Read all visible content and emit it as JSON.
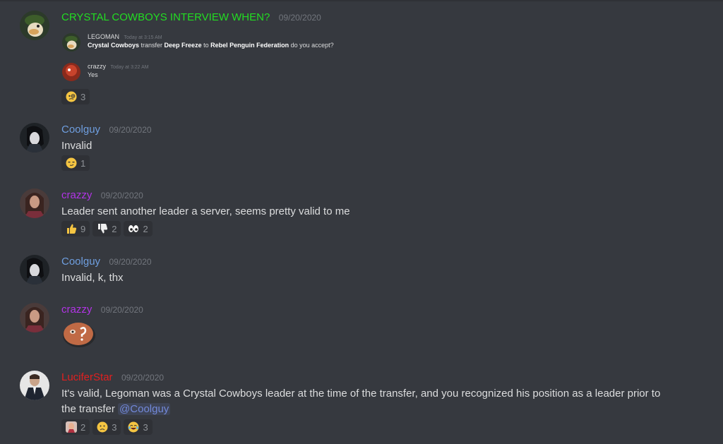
{
  "colors": {
    "background": "#36393f",
    "name_green": "#22dd22",
    "name_blue": "#6f9fe0",
    "name_purple": "#b234e6",
    "name_red": "#e02020",
    "timestamp": "#72767d",
    "mention": "#7289da"
  },
  "messages": [
    {
      "username": "CRYSTAL COWBOYS INTERVIEW WHEN?",
      "timestamp": "09/20/2020",
      "avatar_icon": "duck-avatar-icon",
      "embed": [
        {
          "username": "LEGOMAN",
          "timestamp": "Today at 3:15 AM",
          "text_parts": {
            "p1": "Crystal Cowboys",
            "p2": " transfer ",
            "p3": "Deep Freeze",
            "p4": " to ",
            "p5": "Rebel Penguin Federation",
            "p6": " do you accept?"
          }
        },
        {
          "username": "crazzy",
          "timestamp": "Today at 3:22 AM",
          "text": "Yes"
        }
      ],
      "reactions": [
        {
          "emoji": "monocle-emoji",
          "count": "3"
        }
      ]
    },
    {
      "username": "Coolguy",
      "timestamp": "09/20/2020",
      "text": "Invalid",
      "reactions": [
        {
          "emoji": "smirk-emoji",
          "count": "1"
        }
      ]
    },
    {
      "username": "crazzy",
      "timestamp": "09/20/2020",
      "text": "Leader sent another leader a server, seems pretty valid to me",
      "reactions": [
        {
          "emoji": "thumbs-up-emoji",
          "count": "9"
        },
        {
          "emoji": "thumbs-down-emoji",
          "count": "2"
        },
        {
          "emoji": "eyes-emoji",
          "count": "2"
        }
      ]
    },
    {
      "username": "Coolguy",
      "timestamp": "09/20/2020",
      "text": "Invalid, k, thx"
    },
    {
      "username": "crazzy",
      "timestamp": "09/20/2020",
      "sticker": "confused-face-sticker"
    },
    {
      "username": "LuciferStar",
      "timestamp": "09/20/2020",
      "text_line1": "It's valid, Legoman was a Crystal Cowboys leader at the time of the transfer, and you recognized his position as a leader prior to",
      "text_line2": "the transfer ",
      "mention": "@Coolguy",
      "reactions": [
        {
          "emoji": "face-emoji",
          "count": "2"
        },
        {
          "emoji": "frown-emoji",
          "count": "3"
        },
        {
          "emoji": "joy-emoji",
          "count": "3"
        }
      ]
    }
  ]
}
